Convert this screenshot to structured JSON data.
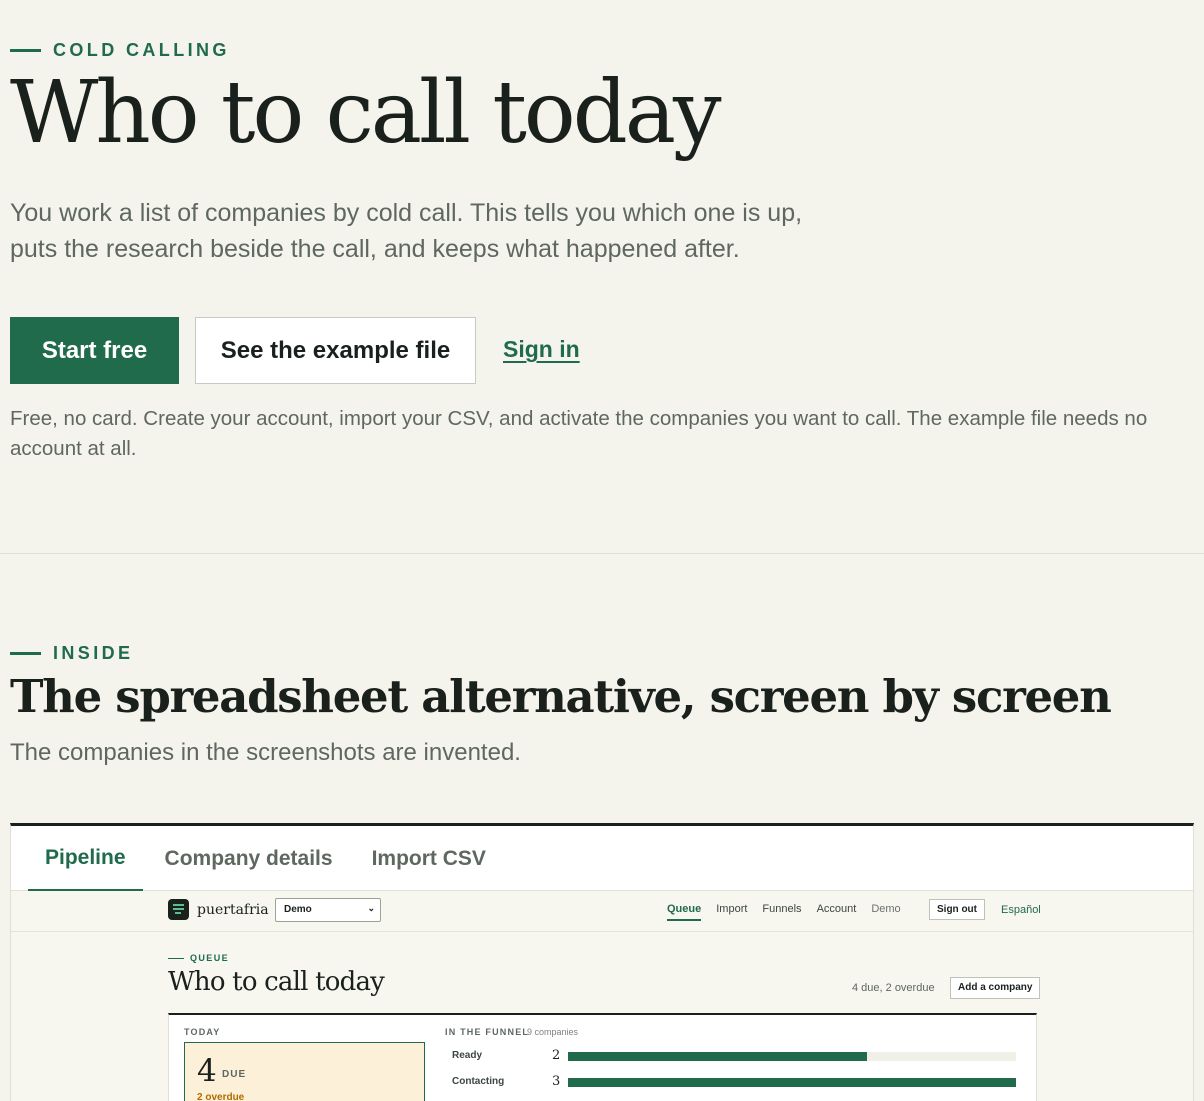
{
  "hero": {
    "eyebrow": "COLD CALLING",
    "title": "Who to call today",
    "subtitle": "You work a list of companies by cold call. This tells you which one is up, puts the research beside the call, and keeps what happened after.",
    "start_label": "Start free",
    "example_label": "See the example file",
    "signin_label": "Sign in",
    "note": "Free, no card. Create your account, import your CSV, and activate the companies you want to call. The example file needs no account at all."
  },
  "inside": {
    "eyebrow": "INSIDE",
    "title": "The spreadsheet alternative, screen by screen",
    "subtitle": "The companies in the screenshots are invented."
  },
  "tabs": [
    {
      "label": "Pipeline",
      "active": true
    },
    {
      "label": "Company details",
      "active": false
    },
    {
      "label": "Import CSV",
      "active": false
    }
  ],
  "app": {
    "brand": "puertafria",
    "workspace_selected": "Demo",
    "nav": {
      "queue": "Queue",
      "import": "Import",
      "funnels": "Funnels",
      "account": "Account",
      "demo": "Demo",
      "signout": "Sign out",
      "language": "Español"
    },
    "queue": {
      "eyebrow": "QUEUE",
      "title": "Who to call today",
      "due_summary": "4 due, 2 overdue",
      "add_label": "Add a company"
    },
    "today": {
      "label": "TODAY",
      "count": "4",
      "due_label": "DUE",
      "overdue": "2 overdue"
    },
    "funnel": {
      "label": "IN THE FUNNEL",
      "count_label": "9 companies",
      "rows": [
        {
          "label": "Ready",
          "count": "2",
          "fraction": 0.667
        },
        {
          "label": "Contacting",
          "count": "3",
          "fraction": 1.0
        }
      ]
    }
  },
  "colors": {
    "accent": "#1f6b4c",
    "background": "#f5f4ec",
    "ink": "#1a211d",
    "overdue": "#b06a00"
  }
}
